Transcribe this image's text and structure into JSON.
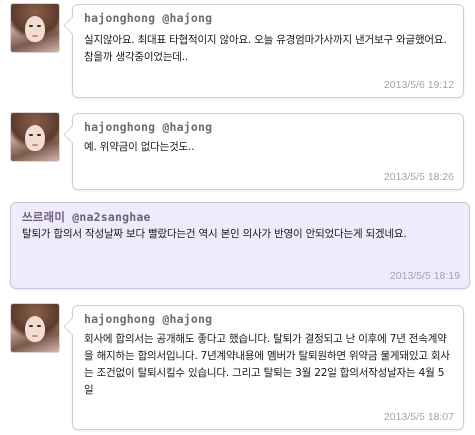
{
  "tweets": [
    {
      "author": "hajonghong @hajong",
      "text": "실지않아요. 최대표 타협적이지 않아요. 오늘 유경엄마가사까지 낸거보구 와글했어요. 참을까 생각중이었는데..",
      "time": "2013/5/6 19:12",
      "avatar_icon": "profile-photo-icon"
    },
    {
      "author": "hajonghong @hajong",
      "text": "예. 위약금이 없다는것도..",
      "time": "2013/5/5 18:26",
      "avatar_icon": "profile-photo-icon"
    },
    {
      "author": "쓰르래미 @na2sanghae",
      "text": "탈퇴가 합의서 작성날짜 보다 빨랐다는건 역시 본인 의사가 반영이 안되었다는게 되겠네요.",
      "time": "2013/5/5 18:19"
    },
    {
      "author": "hajonghong @hajong",
      "text": "회사에 합의서는 공개해도 좋다고 했습니다. 탈퇴가 결정되고 난 이후에 7년 전속계약을 해지하는 합의서입니다. 7년계약내용에 멤버가 탈퇴원하면 위약금 물게돼있고 회사는 조건없이 탈퇴시킬수 있습니다. 그리고 탈퇴는 3월 22일 합의서작성날자는 4월 5일",
      "time": "2013/5/5 18:07",
      "avatar_icon": "profile-photo-icon"
    }
  ],
  "colors": {
    "bubble_border": "#cfcfd8",
    "reply_background": "#efebfb",
    "timestamp": "#a3a3b0",
    "author": "#6b6b75"
  }
}
